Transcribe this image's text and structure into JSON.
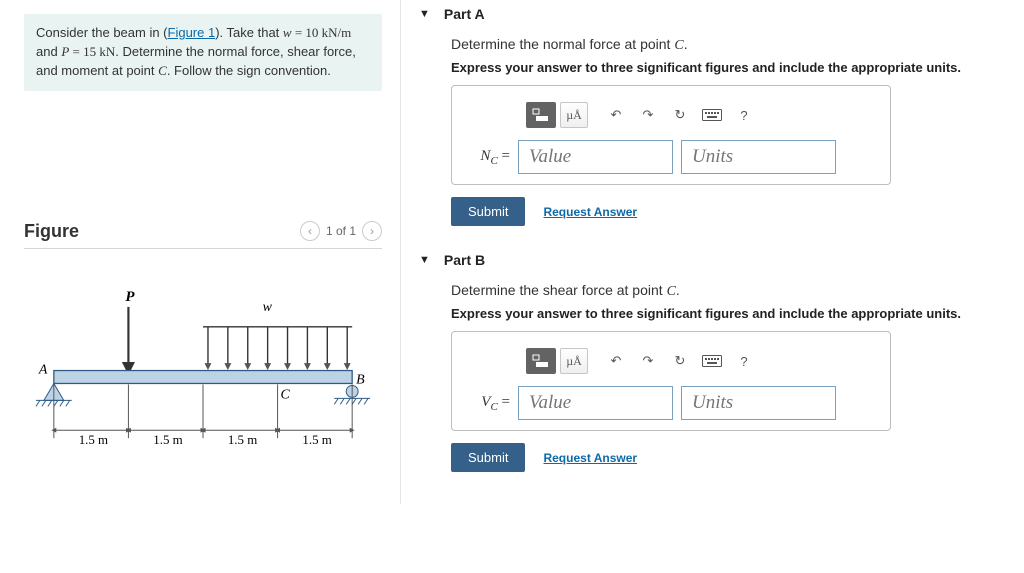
{
  "problem": {
    "intro_pre": "Consider the beam in (",
    "figure_link": "Figure 1",
    "intro_post": "). Take that ",
    "eq1_lhs": "w",
    "eq1_rhs": " = 10 kN/m",
    "eq_and": " and ",
    "eq2_lhs": "P",
    "eq2_rhs": " = 15 kN",
    "tail": ". Determine the normal force, shear force, and moment at point ",
    "point": "C",
    "tail2": ". Follow the sign convention."
  },
  "figure": {
    "title": "Figure",
    "pager": "1 of 1",
    "labels": {
      "P": "P",
      "w": "w",
      "A": "A",
      "B": "B",
      "C": "C"
    },
    "dims": [
      "1.5 m",
      "1.5 m",
      "1.5 m",
      "1.5 m"
    ]
  },
  "toolbar": {
    "units_button": "µÅ",
    "help": "?"
  },
  "partA": {
    "title": "Part A",
    "instruction_pre": "Determine the normal force at point ",
    "point": "C",
    "instruction_post": ".",
    "bold": "Express your answer to three significant figures and include the appropriate units.",
    "var_sym": "N",
    "var_sub": "C",
    "equals": " = ",
    "value_ph": "Value",
    "units_ph": "Units",
    "submit": "Submit",
    "request": "Request Answer"
  },
  "partB": {
    "title": "Part B",
    "instruction_pre": "Determine the shear force at point ",
    "point": "C",
    "instruction_post": ".",
    "bold": "Express your answer to three significant figures and include the appropriate units.",
    "var_sym": "V",
    "var_sub": "C",
    "equals": " = ",
    "value_ph": "Value",
    "units_ph": "Units",
    "submit": "Submit",
    "request": "Request Answer"
  }
}
